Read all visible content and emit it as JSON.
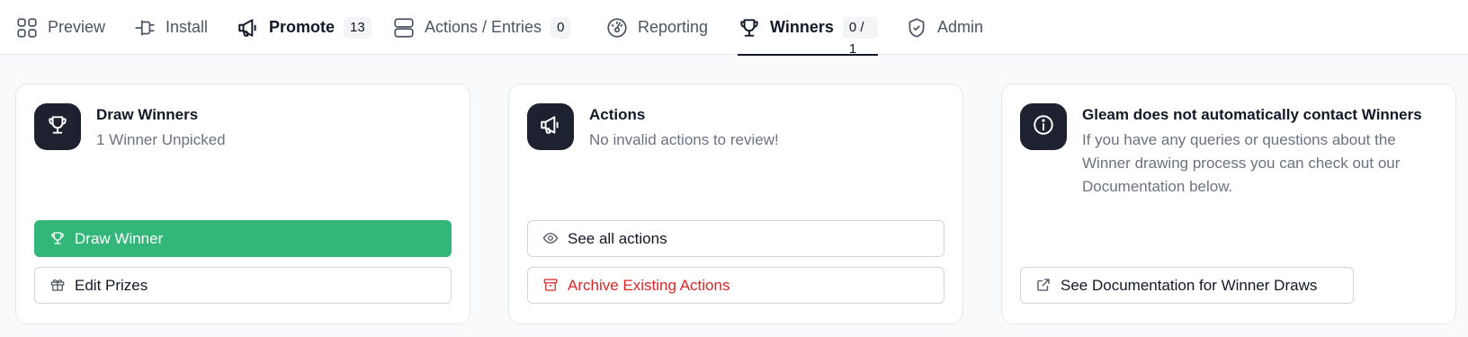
{
  "nav": {
    "tabs": [
      {
        "label": "Preview",
        "icon": "grid-icon"
      },
      {
        "label": "Install",
        "icon": "plug-icon"
      },
      {
        "label": "Promote",
        "icon": "megaphone-icon",
        "badge": "13"
      },
      {
        "label": "Actions / Entries",
        "icon": "server-icon",
        "badge": "0"
      },
      {
        "label": "Reporting",
        "icon": "gauge-icon"
      },
      {
        "label": "Winners",
        "icon": "trophy-icon",
        "badge": "0 / 1",
        "active": true
      },
      {
        "label": "Admin",
        "icon": "shield-check-icon"
      }
    ]
  },
  "cards": {
    "draw": {
      "icon": "trophy-icon",
      "title": "Draw Winners",
      "description": "1 Winner Unpicked",
      "primary_button": "Draw Winner",
      "secondary_button": "Edit Prizes"
    },
    "actions": {
      "icon": "megaphone-icon",
      "title": "Actions",
      "description": "No invalid actions to review!",
      "primary_button": "See all actions",
      "danger_button": "Archive Existing Actions"
    },
    "info": {
      "icon": "info-icon",
      "title": "Gleam does not automatically contact Winners",
      "description": "If you have any queries or questions about the Winner drawing process you can check out our Documentation below.",
      "link_button": "See Documentation for Winner Draws"
    }
  },
  "colors": {
    "accent_green": "#33b679",
    "icon_tile": "#1e2130",
    "danger": "#dc2626"
  }
}
